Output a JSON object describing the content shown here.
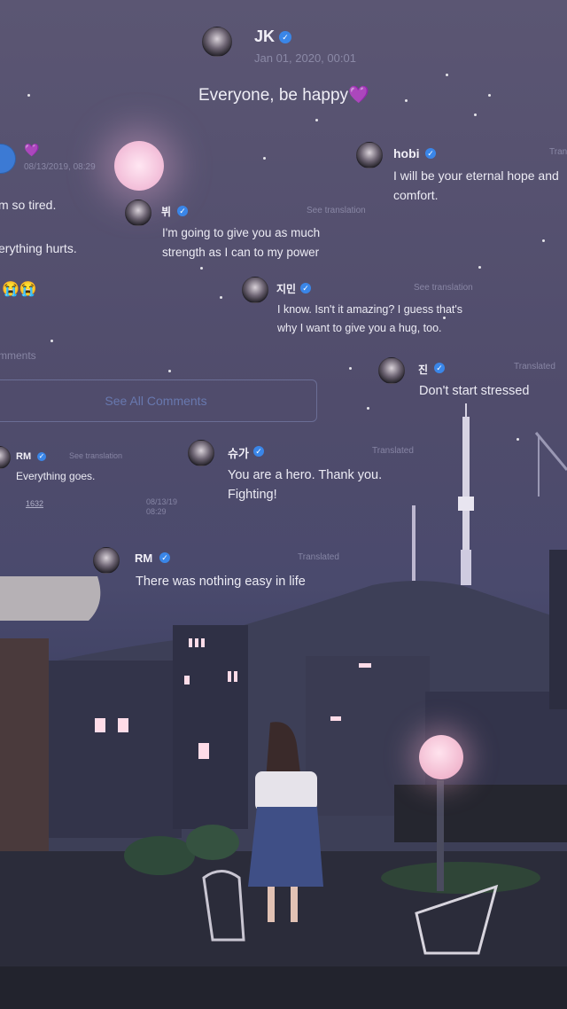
{
  "posts": {
    "jk": {
      "name": "JK",
      "date": "Jan 01, 2020, 00:01",
      "text": "Everyone, be happy💜"
    },
    "left": {
      "date": "08/13/2019, 08:29",
      "line1": "m so tired.",
      "line2": "erything hurts.",
      "emoji": "😭😭",
      "comments": "mments",
      "see_all": "See All Comments"
    },
    "hobi": {
      "name": "hobi",
      "tag": "Tran",
      "text": "I will be your eternal hope and comfort."
    },
    "v": {
      "name": "뷔",
      "tag": "See translation",
      "text": "I'm going to give you as much strength as I can to my power"
    },
    "jimin": {
      "name": "지민",
      "tag": "See translation",
      "text": "I know. Isn't it amazing? I guess that's why I want to give you a hug, too."
    },
    "jin": {
      "name": "진",
      "tag": "Translated",
      "text": "Don't start stressed"
    },
    "rm_small": {
      "name": "RM",
      "tag": "See translation",
      "text": "Everything goes.",
      "count": "1632",
      "date": "08/13/19\n08:29"
    },
    "suga": {
      "name": "슈가",
      "tag": "Translated",
      "text": "You are a hero. Thank you. Fighting!"
    },
    "rm": {
      "name": "RM",
      "tag": "Translated",
      "text": "There was nothing easy in life"
    }
  },
  "colors": {
    "verified": "#3a86e8",
    "moon": "#f2bdd8",
    "accent": "#8a3fd1"
  }
}
